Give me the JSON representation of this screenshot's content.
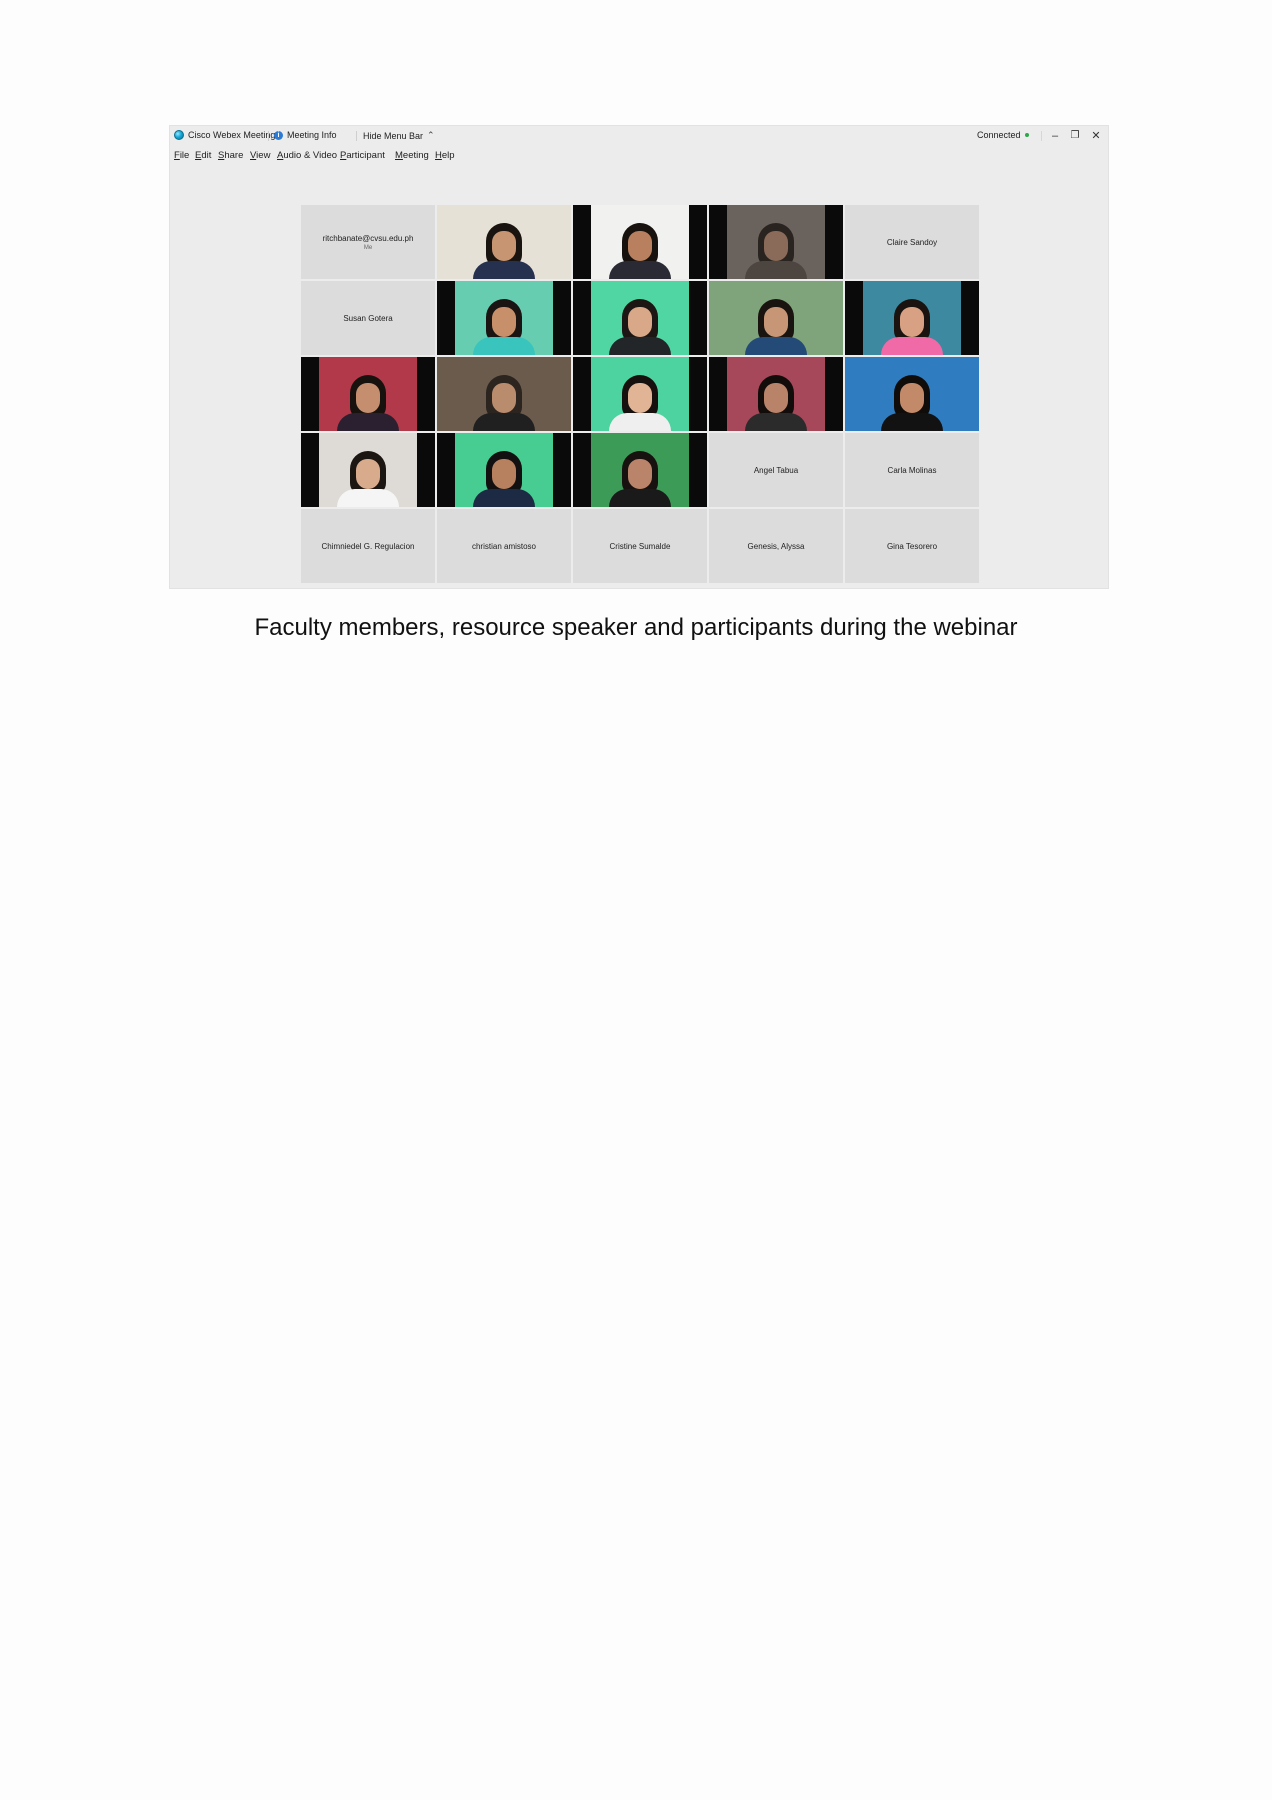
{
  "titlebar": {
    "app_name": "Cisco Webex Meetings",
    "meeting_info": "Meeting Info",
    "hide_menu_bar": "Hide Menu Bar",
    "status": "Connected"
  },
  "menu": [
    {
      "key": "F",
      "rest": "ile"
    },
    {
      "key": "E",
      "rest": "dit"
    },
    {
      "key": "S",
      "rest": "hare"
    },
    {
      "key": "V",
      "rest": "iew"
    },
    {
      "key": "A",
      "rest": "udio & Video"
    },
    {
      "key": "P",
      "rest": "articipant"
    },
    {
      "key": "M",
      "rest": "eeting"
    },
    {
      "key": "H",
      "rest": "elp"
    }
  ],
  "tiles": [
    {
      "type": "name",
      "name": "ritchbanate@cvsu.edu.ph",
      "sub": "Me"
    },
    {
      "type": "video",
      "bg": "#e6e1d6",
      "skin": "#c89572",
      "hair": "#1a1410",
      "shirt": "#26304f",
      "full": true
    },
    {
      "type": "video",
      "bg": "#f1f1ef",
      "skin": "#b9805f",
      "hair": "#18120e",
      "shirt": "#2a2a35"
    },
    {
      "type": "video",
      "bg": "#6a625c",
      "skin": "#8a6a58",
      "hair": "#2a2420",
      "shirt": "#4d4640"
    },
    {
      "type": "name",
      "name": "Claire Sandoy"
    },
    {
      "type": "name",
      "name": "Susan Gotera"
    },
    {
      "type": "video",
      "bg": "#67cdb0",
      "skin": "#c8906a",
      "hair": "#1a1513",
      "shirt": "#39c4bd"
    },
    {
      "type": "video",
      "bg": "#4fd6a2",
      "skin": "#d8a889",
      "hair": "#1c1614",
      "shirt": "#222628"
    },
    {
      "type": "video",
      "bg": "#7fa37a",
      "skin": "#c79676",
      "hair": "#1a1410",
      "shirt": "#244a78",
      "full": true
    },
    {
      "type": "video",
      "bg": "#3d8aa0",
      "skin": "#d8a183",
      "hair": "#1a130f",
      "shirt": "#f06aa8"
    },
    {
      "type": "video",
      "bg": "#b2394a",
      "skin": "#c48e6f",
      "hair": "#18120f",
      "shirt": "#2a2030"
    },
    {
      "type": "video",
      "bg": "#6b5b4c",
      "skin": "#b98c6e",
      "hair": "#2b241f",
      "shirt": "#202020",
      "full": true
    },
    {
      "type": "video",
      "bg": "#4cd3a0",
      "skin": "#e0b495",
      "hair": "#16110e",
      "shirt": "#efefef"
    },
    {
      "type": "video",
      "bg": "#a6475a",
      "skin": "#b9836a",
      "hair": "#120d0b",
      "shirt": "#2b2b2b"
    },
    {
      "type": "video",
      "bg": "#2f7dc0",
      "skin": "#c28a68",
      "hair": "#0f0c0a",
      "shirt": "#121212",
      "full": true
    },
    {
      "type": "video",
      "bg": "#dedbd6",
      "skin": "#d9ab8d",
      "hair": "#1c1612",
      "shirt": "#f5f5f5"
    },
    {
      "type": "video",
      "bg": "#47cc92",
      "skin": "#b7805e",
      "hair": "#121010",
      "shirt": "#1c2a44"
    },
    {
      "type": "video",
      "bg": "#3d9b58",
      "skin": "#b9846a",
      "hair": "#17120f",
      "shirt": "#1a1a1a"
    },
    {
      "type": "name",
      "name": "Angel Tabua"
    },
    {
      "type": "name",
      "name": "Carla Molinas"
    },
    {
      "type": "name",
      "name": "Chimniedel G. Regulacion"
    },
    {
      "type": "name",
      "name": "christian amistoso"
    },
    {
      "type": "name",
      "name": "Cristine Sumalde"
    },
    {
      "type": "name",
      "name": "Genesis, Alyssa"
    },
    {
      "type": "name",
      "name": "Gina Tesorero"
    }
  ],
  "caption": "Faculty members, resource speaker and participants during the webinar"
}
